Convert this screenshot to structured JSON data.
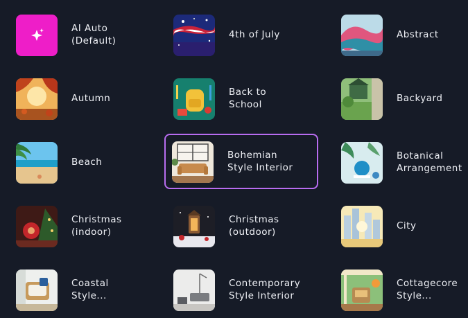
{
  "styles": [
    {
      "label": "AI Auto\n(Default)",
      "thumb": "ai-auto-sparkle-icon",
      "selected": false
    },
    {
      "label": "4th of July",
      "thumb": "fireworks-flag-image",
      "selected": false
    },
    {
      "label": "Abstract",
      "thumb": "abstract-waves-image",
      "selected": false
    },
    {
      "label": "Autumn",
      "thumb": "autumn-leaves-image",
      "selected": false
    },
    {
      "label": "Back to\nSchool",
      "thumb": "school-backpack-image",
      "selected": false
    },
    {
      "label": "Backyard",
      "thumb": "backyard-garden-image",
      "selected": false
    },
    {
      "label": "Beach",
      "thumb": "beach-palm-image",
      "selected": false
    },
    {
      "label": "Bohemian\nStyle Interior",
      "thumb": "bohemian-sofa-image",
      "selected": true
    },
    {
      "label": "Botanical\nArrangement",
      "thumb": "botanical-plants-image",
      "selected": false
    },
    {
      "label": "Christmas\n(indoor)",
      "thumb": "christmas-tree-image",
      "selected": false
    },
    {
      "label": "Christmas\n(outdoor)",
      "thumb": "christmas-lantern-image",
      "selected": false
    },
    {
      "label": "City",
      "thumb": "city-skyline-image",
      "selected": false
    },
    {
      "label": "Coastal\nStyle...",
      "thumb": "coastal-chair-image",
      "selected": false
    },
    {
      "label": "Contemporary\nStyle Interior",
      "thumb": "contemporary-room-image",
      "selected": false
    },
    {
      "label": "Cottagecore\nStyle...",
      "thumb": "cottage-porch-image",
      "selected": false
    }
  ],
  "colors": {
    "background": "#161b27",
    "selected_border": "#b86cf0",
    "ai_auto_tile": "#ee1ec8",
    "text": "#eef0f5"
  }
}
